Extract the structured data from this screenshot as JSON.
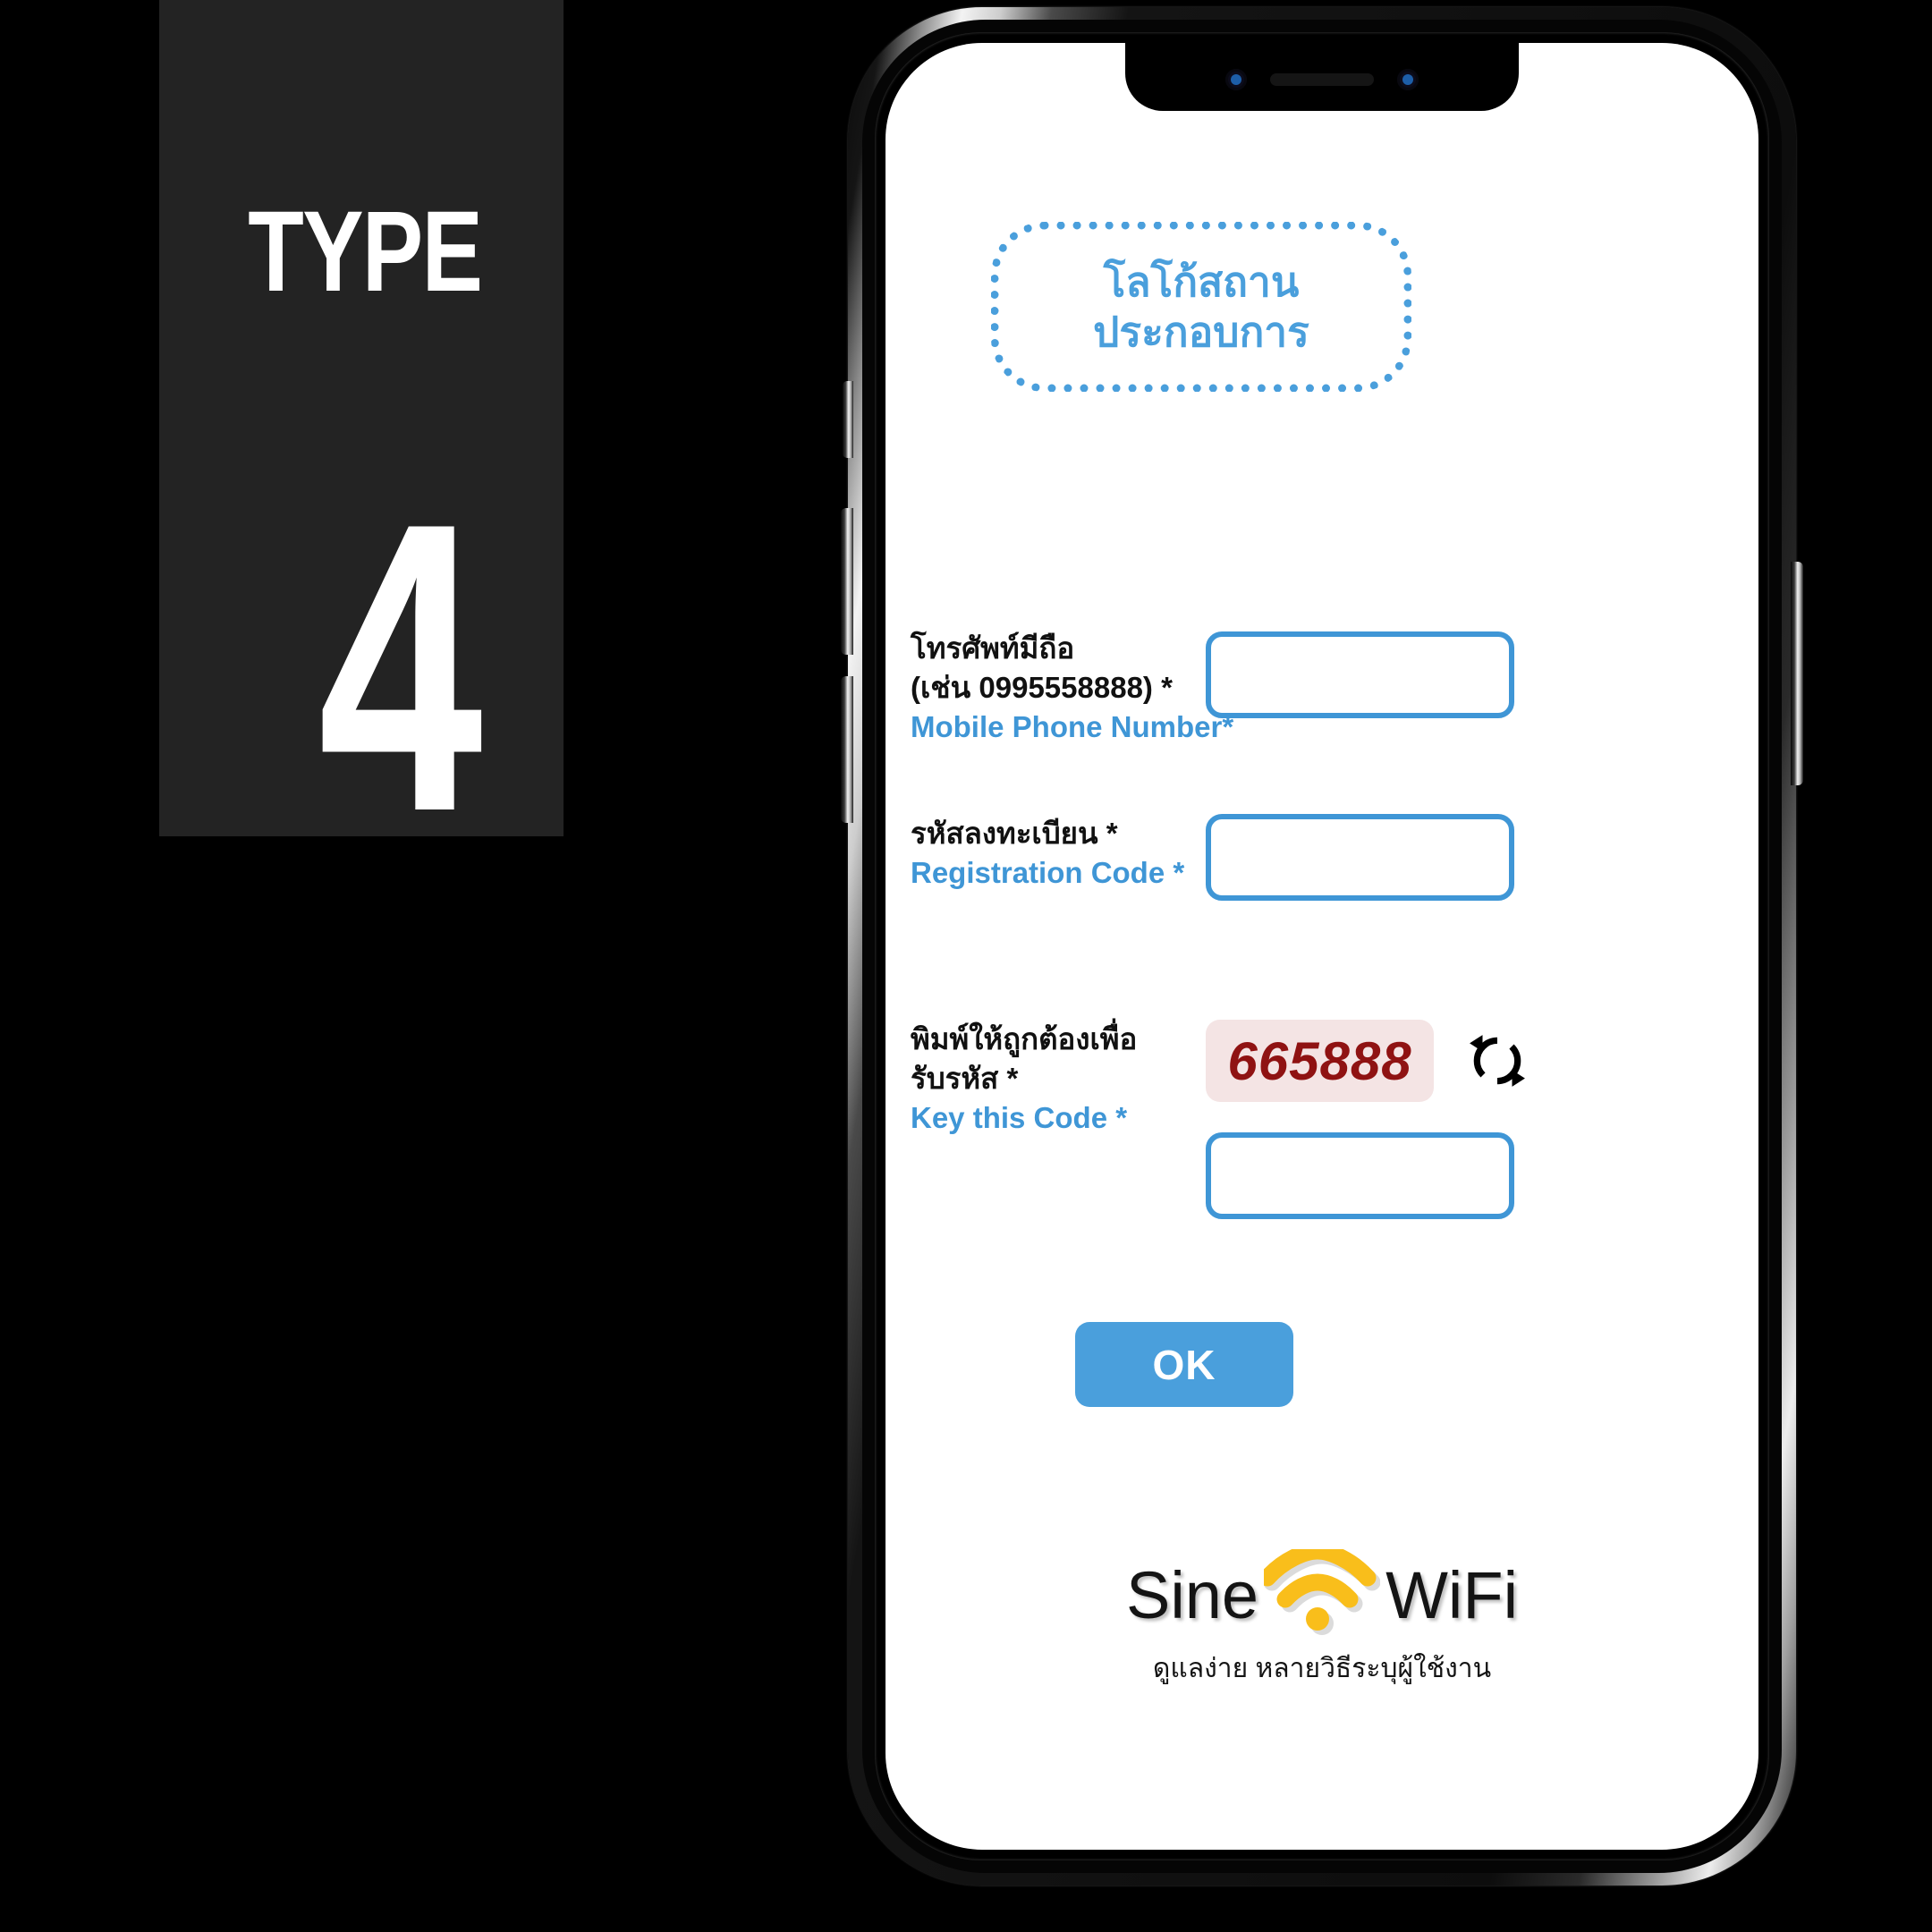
{
  "left_panel": {
    "word": "TYPE",
    "number": "4"
  },
  "phone": {
    "notch": {
      "speaker": "earpiece-speaker",
      "camera": "front-camera"
    },
    "side_buttons": {
      "silent": "silent-switch",
      "volume_up": "volume-up-button",
      "volume_down": "volume-down-button",
      "power": "power-button"
    }
  },
  "screen": {
    "logo_placeholder": {
      "line1": "โลโก้สถาน",
      "line2": "ประกอบการ",
      "color": "#4a9fdc"
    },
    "fields": [
      {
        "id": "mobile-phone-number",
        "label_th_line1": "โทรศัพท์มีถือ",
        "label_th_line2": "(เช่น 0995558888) *",
        "label_en": "Mobile Phone Number*",
        "value": "",
        "placeholder": ""
      },
      {
        "id": "registration-code",
        "label_th_line1": "รหัสลงทะเบียน *",
        "label_th_line2": "",
        "label_en": "Registration Code *",
        "value": "",
        "placeholder": ""
      },
      {
        "id": "key-this-code",
        "label_th_line1": "พิมพ์ให้ถูกต้องเพื่อ",
        "label_th_line2": "รับรหัส *",
        "label_en": "Key this Code *",
        "value": "",
        "placeholder": ""
      }
    ],
    "captcha": {
      "code": "665888",
      "code_color": "#8f1212",
      "background": "#f4e4e4",
      "refresh_icon": "refresh-icon"
    },
    "submit_button": {
      "label": "OK",
      "color": "#4a9fdc"
    },
    "brand": {
      "word_left": "Sine",
      "word_right": "WiFi",
      "icon": "wifi-icon",
      "icon_color": "#f9be1b",
      "tagline": "ดูแลง่าย หลายวิธีระบุผู้ใช้งาน"
    }
  }
}
